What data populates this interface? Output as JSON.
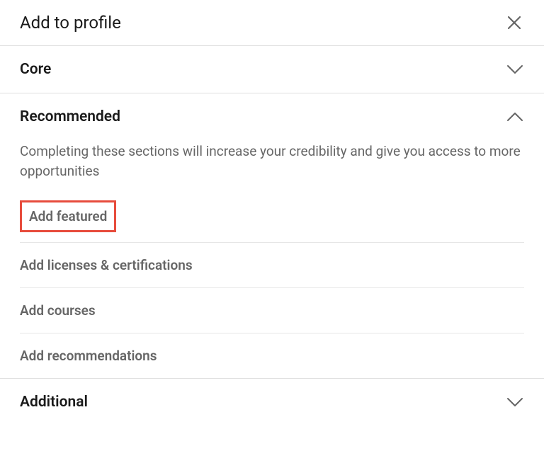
{
  "header": {
    "title": "Add to profile"
  },
  "sections": {
    "core": {
      "title": "Core",
      "expanded": false
    },
    "recommended": {
      "title": "Recommended",
      "expanded": true,
      "description": "Completing these sections will increase your credibility and give you access to more opportunities",
      "options": {
        "featured": "Add featured",
        "licenses": "Add licenses & certifications",
        "courses": "Add courses",
        "recommendations": "Add recommendations"
      }
    },
    "additional": {
      "title": "Additional",
      "expanded": false
    }
  }
}
